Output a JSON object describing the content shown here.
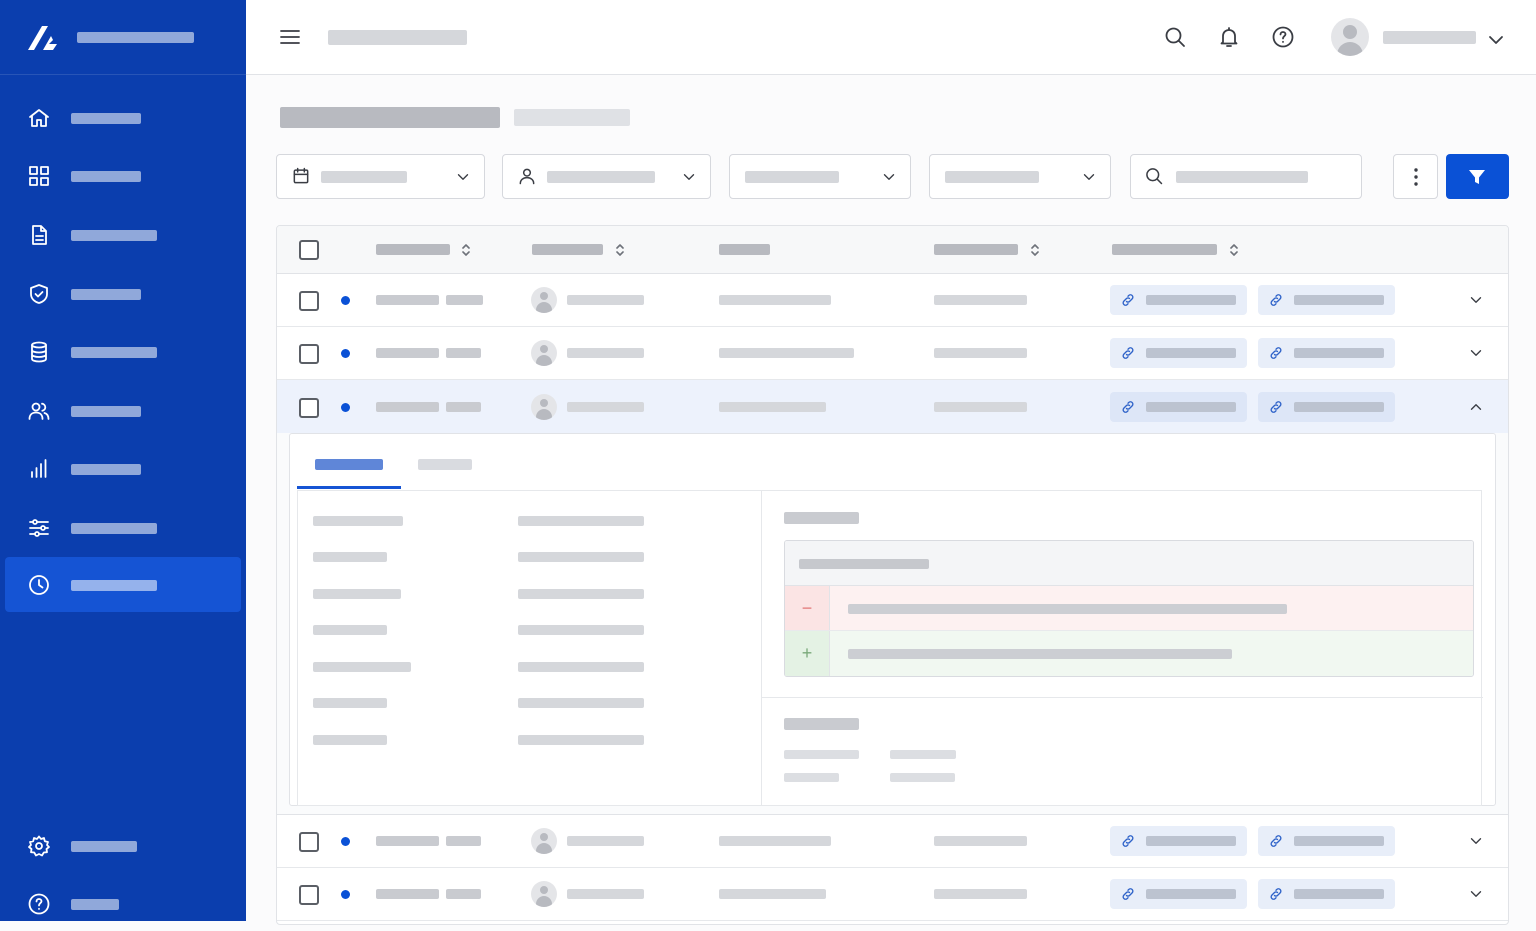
{
  "app": {
    "brand_icon": "logo-mark-icon"
  },
  "sidebar": {
    "items": [
      {
        "icon": "home-icon",
        "active": false
      },
      {
        "icon": "grid-icon",
        "active": false
      },
      {
        "icon": "document-icon",
        "active": false
      },
      {
        "icon": "shield-check-icon",
        "active": false
      },
      {
        "icon": "database-icon",
        "active": false
      },
      {
        "icon": "users-icon",
        "active": false
      },
      {
        "icon": "bar-chart-icon",
        "active": false
      },
      {
        "icon": "sliders-icon",
        "active": false
      },
      {
        "icon": "clock-icon",
        "active": true
      }
    ],
    "bottom_items": [
      {
        "icon": "gear-icon"
      },
      {
        "icon": "help-circle-icon"
      }
    ]
  },
  "header": {
    "icons": [
      "menu-icon",
      "search-icon",
      "bell-icon",
      "help-circle-icon",
      "avatar",
      "chevron-down-icon"
    ]
  },
  "filters": {
    "icons": [
      "calendar-icon",
      "user-icon",
      "",
      "",
      "search-icon"
    ],
    "has_dropdown": [
      true,
      true,
      true,
      true,
      false
    ]
  },
  "table": {
    "rows": [
      {
        "expanded": false
      },
      {
        "expanded": false
      },
      {
        "expanded": true
      },
      {
        "expanded": false
      },
      {
        "expanded": false
      }
    ]
  },
  "detail": {
    "active_tab_index": 0,
    "diff": {
      "removed_marker": "−",
      "added_marker": "+"
    }
  },
  "colors": {
    "sidebar": "#0b3eae",
    "sidebar_active": "#1554d4",
    "primary": "#0a51d6",
    "diff_removed_bg": "#fdf1f1",
    "diff_added_bg": "#f1f8f1"
  }
}
